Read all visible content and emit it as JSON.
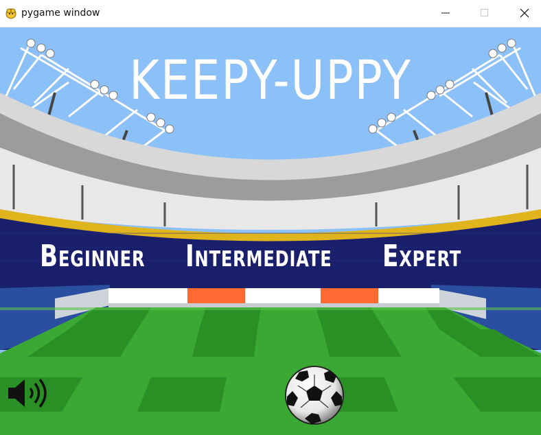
{
  "window": {
    "title": "pygame window",
    "controls": [
      "minimize",
      "maximize",
      "close"
    ]
  },
  "game": {
    "title": "KEEPY-UPPY",
    "menu": [
      {
        "label": "Beginner"
      },
      {
        "label": "Intermediate"
      },
      {
        "label": "Expert"
      }
    ],
    "sound_icon": "speaker-icon",
    "ball_icon": "soccer-ball-icon"
  },
  "colors": {
    "sky": "#8cc0f8",
    "stand_navy": "#1a1f6b",
    "pitch_light": "#3aa832",
    "pitch_dark": "#2a8f24",
    "goal_orange": "#ff6a32",
    "roof_gray": "#9c9c9c",
    "gold_trim": "#e0b41c"
  }
}
